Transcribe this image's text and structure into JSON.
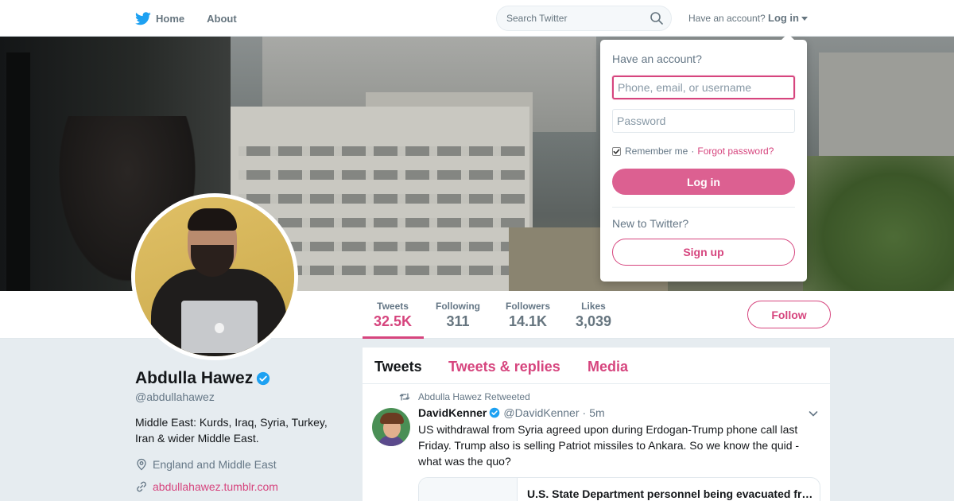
{
  "colors": {
    "accent": "#d6457e",
    "twitter_blue": "#1da1f2",
    "verified_blue": "#1da1f2"
  },
  "nav": {
    "logo_icon": "twitter-bird-icon",
    "home_label": "Home",
    "about_label": "About",
    "search_placeholder": "Search Twitter",
    "search_icon": "search-icon",
    "account_prompt": "Have an account?",
    "login_label": "Log in"
  },
  "login_dropdown": {
    "title": "Have an account?",
    "username_placeholder": "Phone, email, or username",
    "password_placeholder": "Password",
    "remember_label": "Remember me",
    "remember_checked": true,
    "separator": "·",
    "forgot_label": "Forgot password?",
    "login_button": "Log in",
    "new_prompt": "New to Twitter?",
    "signup_button": "Sign up"
  },
  "profile": {
    "name": "Abdulla Hawez",
    "handle": "@abdullahawez",
    "verified": true,
    "bio": "Middle East: Kurds, Iraq, Syria, Turkey, Iran & wider Middle East.",
    "location": "England and Middle East",
    "url": "abdullahawez.tumblr.com"
  },
  "stats": [
    {
      "label": "Tweets",
      "value": "32.5K",
      "active": true
    },
    {
      "label": "Following",
      "value": "311",
      "active": false
    },
    {
      "label": "Followers",
      "value": "14.1K",
      "active": false
    },
    {
      "label": "Likes",
      "value": "3,039",
      "active": false
    }
  ],
  "follow_button": "Follow",
  "timeline": {
    "tabs": [
      {
        "label": "Tweets",
        "active": true
      },
      {
        "label": "Tweets & replies",
        "active": false
      },
      {
        "label": "Media",
        "active": false
      }
    ],
    "tweets": [
      {
        "retweet_context": "Abdulla Hawez Retweeted",
        "fullname": "DavidKenner",
        "verified": true,
        "username": "@DavidKenner",
        "dot": "·",
        "time": "5m",
        "text": "US withdrawal from Syria agreed upon during Erdogan-Trump phone call last Friday. Trump also is selling Patriot missiles to Ankara. So we know the quid - what was the quo?",
        "card_title": "U.S. State Department personnel being evacuated from Syria"
      }
    ]
  }
}
